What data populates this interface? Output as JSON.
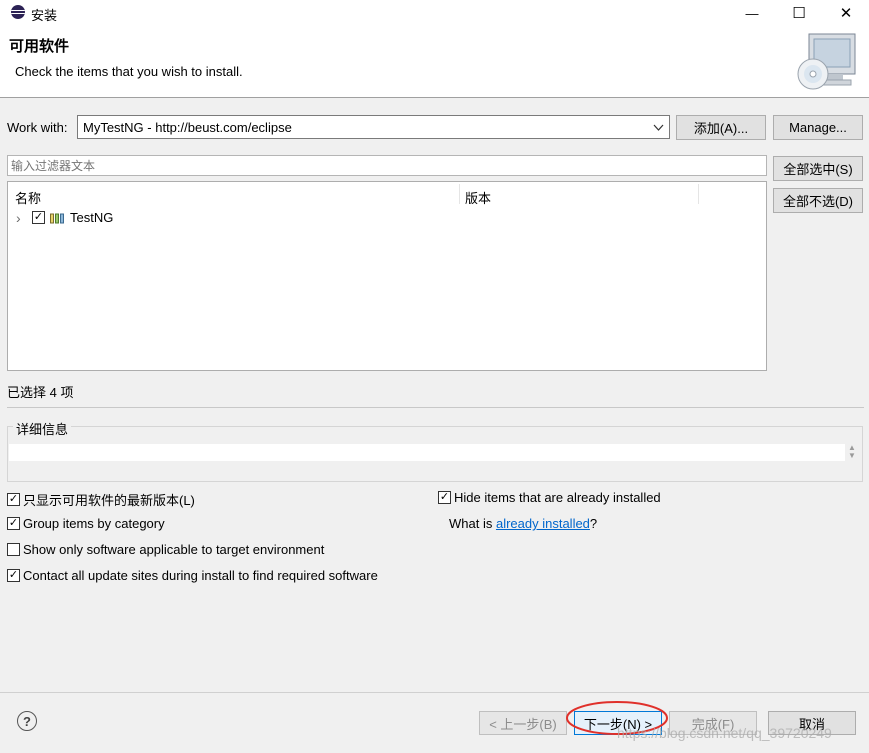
{
  "window": {
    "title": "安装",
    "minimize_glyph": "—",
    "maximize_glyph": "☐",
    "close_glyph": "✕"
  },
  "header": {
    "title": "可用软件",
    "description": "Check the items that you wish to install.",
    "banner_icon": "monitor-cd-icon"
  },
  "work_with": {
    "label": "Work with:",
    "value": "MyTestNG - http://beust.com/eclipse",
    "add_button": "添加(A)...",
    "manage_button": "Manage..."
  },
  "filter": {
    "placeholder": "输入过滤器文本"
  },
  "tree": {
    "columns": [
      "名称",
      "版本"
    ],
    "items": [
      {
        "label": "TestNG",
        "checked": true,
        "expand_glyph": "›",
        "icon": "feature-group-icon"
      }
    ]
  },
  "side_buttons": {
    "select_all": "全部选中(S)",
    "deselect_all": "全部不选(D)"
  },
  "selection_status": "已选择 4 项",
  "details": {
    "title": "详细信息"
  },
  "options": {
    "left": [
      {
        "label": "只显示可用软件的最新版本(L)",
        "checked": true
      },
      {
        "label": "Group items by category",
        "checked": true
      },
      {
        "label": "Show only software applicable to target environment",
        "checked": false
      },
      {
        "label": "Contact all update sites during install to find required software",
        "checked": true
      }
    ],
    "hide_installed": {
      "label": "Hide items that are already installed",
      "checked": true
    },
    "what_is_prefix": "What is ",
    "what_is_link": "already installed",
    "what_is_suffix": "?"
  },
  "footer": {
    "help_glyph": "?",
    "back_button": "< 上一步(B)",
    "next_button": "下一步(N) >",
    "finish_button": "完成(F)",
    "cancel_button": "取消"
  },
  "watermark": "https://blog.csdn.net/qq_39720249",
  "colors": {
    "link": "#0066cc",
    "annotation_red": "#e0302a",
    "focus_border": "#0078d7"
  }
}
